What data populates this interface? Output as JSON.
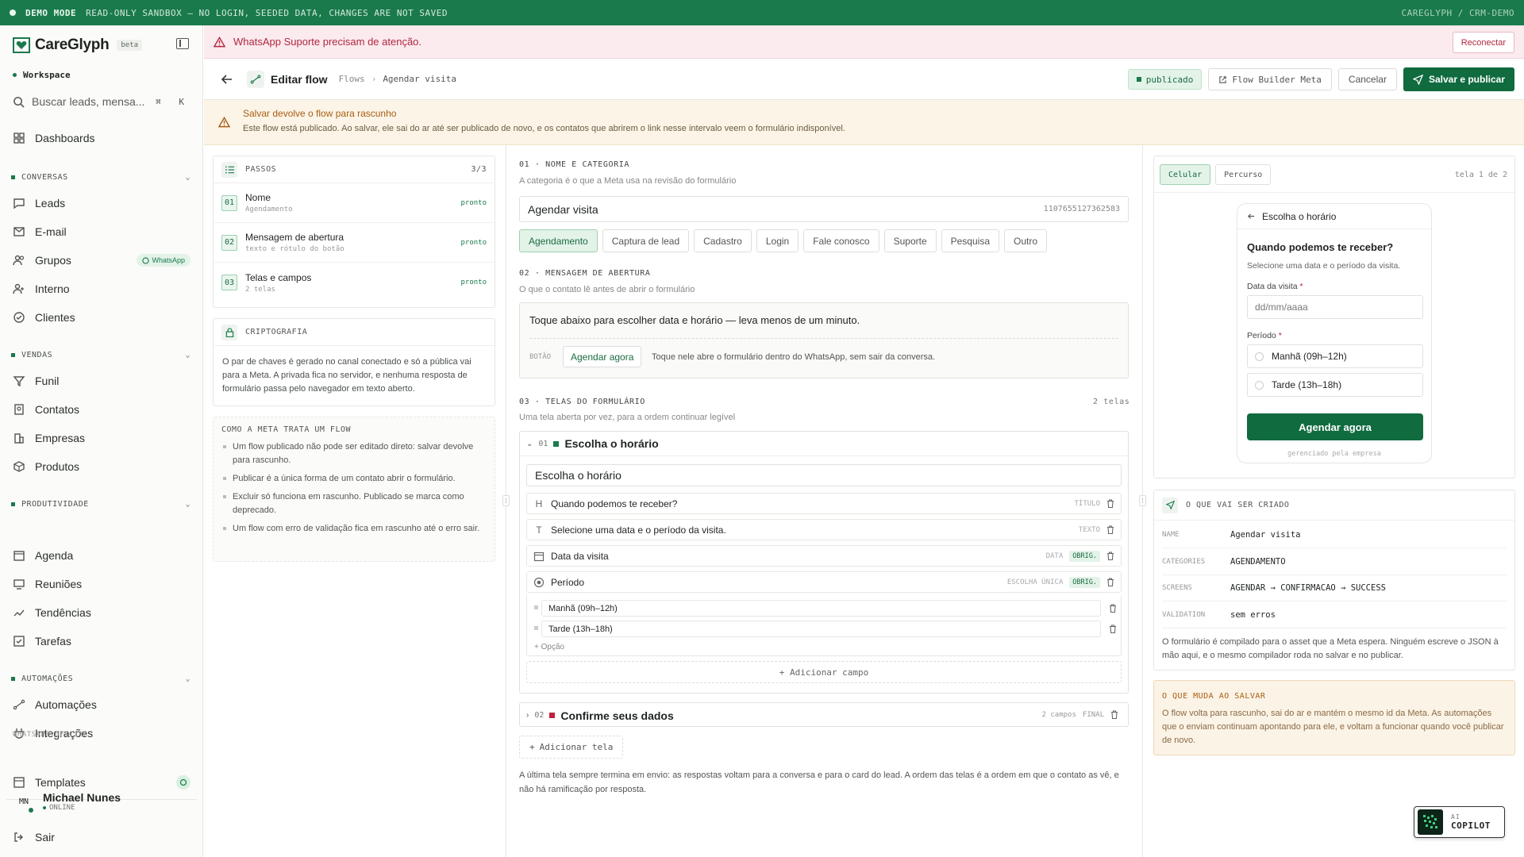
{
  "banner": {
    "mode": "DEMO MODE",
    "text": "READ-ONLY SANDBOX — NO LOGIN, SEEDED DATA, CHANGES ARE NOT SAVED",
    "right": "CAREGLYPH / CRM-DEMO"
  },
  "sidebar": {
    "brand": "CareGlyph",
    "beta": "beta",
    "workspace": "Workspace",
    "search_placeholder": "Buscar leads, mensa...",
    "search_kbd": "⌘ K",
    "dashboards": "Dashboards",
    "sections": [
      {
        "title": "CONVERSAS",
        "items": [
          "Leads",
          "E-mail",
          "Grupos",
          "Interno",
          "Clientes"
        ],
        "grupos_badge": "WhatsApp"
      },
      {
        "title": "VENDAS",
        "items": [
          "Funil",
          "Contatos",
          "Empresas",
          "Produtos"
        ]
      },
      {
        "title": "PRODUTIVIDADE",
        "items": [
          "Agenda",
          "Reuniões",
          "Tendências",
          "Tarefas"
        ]
      },
      {
        "title": "AUTOMAÇÕES",
        "items": [
          "Automações",
          "Integrações"
        ]
      }
    ],
    "whatsapp_label": "WHATSAPP OFICIAL",
    "templates": "Templates",
    "user": {
      "initials": "MN",
      "name": "Michael Nunes",
      "status": "ONLINE"
    },
    "logout": "Sair"
  },
  "alert": {
    "text": "WhatsApp Suporte precisam de atenção.",
    "button": "Reconectar",
    "color": "#b0283e"
  },
  "header": {
    "title": "Editar flow",
    "crumb_root": "Flows",
    "crumb_current": "Agendar visita",
    "status": "publicado",
    "flow_builder": "Flow Builder Meta",
    "cancel": "Cancelar",
    "save": "Salvar e publicar"
  },
  "warning": {
    "title": "Salvar devolve o flow para rascunho",
    "body": "Este flow está publicado. Ao salvar, ele sai do ar até ser publicado de novo, e os contatos que abrirem o link nesse intervalo veem o formulário indisponível."
  },
  "steps": {
    "title": "PASSOS",
    "count": "3/3",
    "items": [
      {
        "num": "01",
        "name": "Nome",
        "sub": "Agendamento",
        "status": "pronto"
      },
      {
        "num": "02",
        "name": "Mensagem de abertura",
        "sub": "texto e rótulo do botão",
        "status": "pronto"
      },
      {
        "num": "03",
        "name": "Telas e campos",
        "sub": "2 telas",
        "status": "pronto"
      }
    ]
  },
  "crypto": {
    "title": "CRIPTOGRAFIA",
    "body": "O par de chaves é gerado no canal conectado e só a pública vai para a Meta. A privada fica no servidor, e nenhuma resposta de formulário passa pelo navegador em texto aberto."
  },
  "howto": {
    "title": "COMO A META TRATA UM FLOW",
    "items": [
      "Um flow publicado não pode ser editado direto: salvar devolve para rascunho.",
      "Publicar é a única forma de um contato abrir o formulário.",
      "Excluir só funciona em rascunho. Publicado se marca como deprecado.",
      "Um flow com erro de validação fica em rascunho até o erro sair."
    ]
  },
  "section1": {
    "heading": "01 · NOME E CATEGORIA",
    "sub": "A categoria é o que a Meta usa na revisão do formulário",
    "name": "Agendar visita",
    "id": "1107655127362583",
    "categories": [
      "Agendamento",
      "Captura de lead",
      "Cadastro",
      "Login",
      "Fale conosco",
      "Suporte",
      "Pesquisa",
      "Outro"
    ],
    "selected": "Agendamento"
  },
  "section2": {
    "heading": "02 · MENSAGEM DE ABERTURA",
    "sub": "O que o contato lê antes de abrir o formulário",
    "text": "Toque abaixo para escolher data e horário — leva menos de um minuto.",
    "button_label": "BOTÃO",
    "button_value": "Agendar agora",
    "button_help": "Toque nele abre o formulário dentro do WhatsApp, sem sair da conversa."
  },
  "section3": {
    "heading": "03 · TELAS DO FORMULÁRIO",
    "count": "2 telas",
    "sub": "Uma tela aberta por vez, para a ordem continuar legível",
    "screen1": {
      "num": "01",
      "title": "Escolha o horário",
      "title_value": "Escolha o horário",
      "fields": [
        {
          "icon": "heading-icon",
          "text": "Quando podemos te receber?",
          "type": "TÍTULO",
          "req": ""
        },
        {
          "icon": "text-icon",
          "text": "Selecione uma data e o período da visita.",
          "type": "TEXTO",
          "req": ""
        },
        {
          "icon": "calendar-icon",
          "text": "Data da visita",
          "type": "DATA",
          "req": "OBRIG."
        },
        {
          "icon": "radio-icon",
          "text": "Período",
          "type": "ESCOLHA ÚNICA",
          "req": "OBRIG."
        }
      ],
      "options": [
        "Manhã (09h–12h)",
        "Tarde (13h–18h)"
      ],
      "add_option": "+ Opção",
      "add_field": "Adicionar campo"
    },
    "screen2": {
      "num": "02",
      "title": "Confirme seus dados",
      "fields": "2 campos",
      "final": "FINAL"
    },
    "add_screen": "Adicionar tela",
    "note": "A última tela sempre termina em envio: as respostas voltam para a conversa e para o card do lead. A ordem das telas é a ordem em que o contato as vê, e não há ramificação por resposta."
  },
  "preview": {
    "tabs": [
      "Celular",
      "Percurso"
    ],
    "page": "tela 1 de 2",
    "phone": {
      "header": "Escolha o horário",
      "question": "Quando podemos te receber?",
      "sub": "Selecione uma data e o período da visita.",
      "date_label": "Data da visita",
      "req": "*",
      "date_placeholder": "dd/mm/aaaa",
      "period_label": "Período",
      "options": [
        "Manhã (09h–12h)",
        "Tarde (13h–18h)"
      ],
      "button": "Agendar agora",
      "footer": "gerenciado pela empresa"
    }
  },
  "created": {
    "title": "O QUE VAI SER CRIADO",
    "rows": [
      {
        "k": "NAME",
        "v": "Agendar visita"
      },
      {
        "k": "CATEGORIES",
        "v": "AGENDAMENTO"
      },
      {
        "k": "SCREENS",
        "v": "AGENDAR → CONFIRMACAO → SUCCESS"
      },
      {
        "k": "VALIDATION",
        "v": "sem erros"
      }
    ],
    "note": "O formulário é compilado para o asset que a Meta espera. Ninguém escreve o JSON à mão aqui, e o mesmo compilador roda no salvar e no publicar."
  },
  "changes": {
    "title": "O QUE MUDA AO SALVAR",
    "body": "O flow volta para rascunho, sai do ar e mantém o mesmo id da Meta. As automações que o enviam continuam apontando para ele, e voltam a funcionar quando você publicar de novo."
  },
  "copilot": {
    "small": "AI",
    "label": "COPILOT"
  },
  "colors": {
    "brand": "#1a7a4c",
    "primary": "#106b3f",
    "danger": "#b0283e",
    "warning": "#a85d12"
  }
}
